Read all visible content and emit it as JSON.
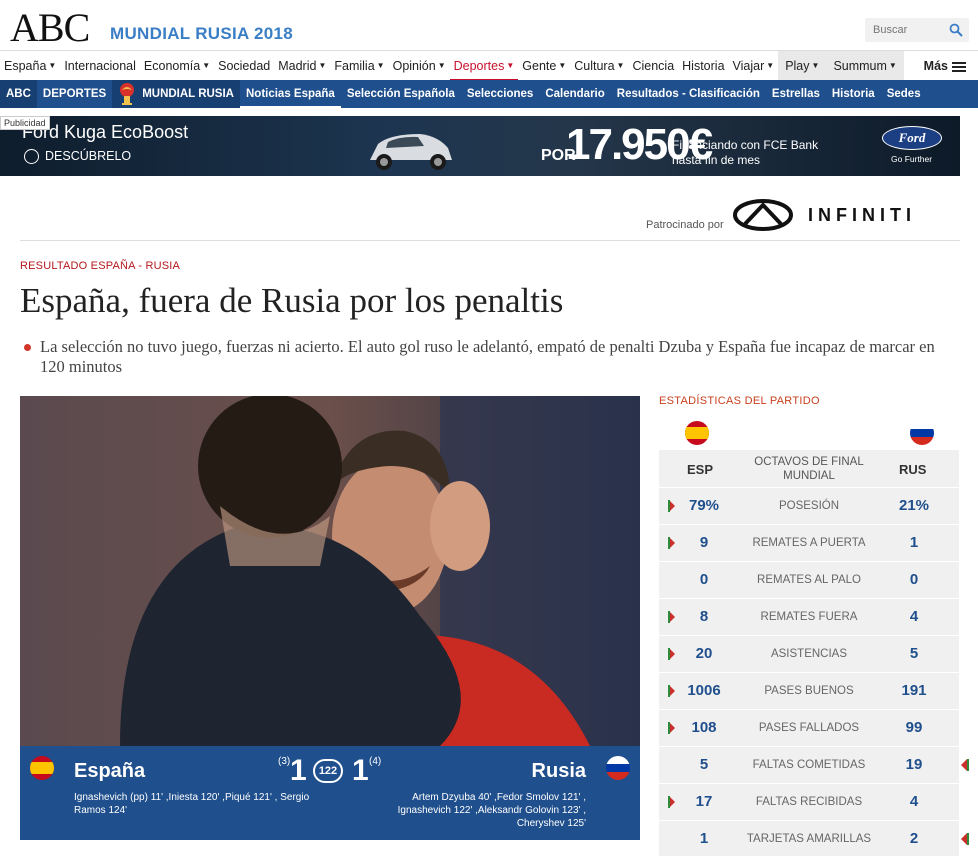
{
  "header": {
    "logo": "ABC",
    "section": "MUNDIAL RUSIA 2018",
    "search_placeholder": "Buscar"
  },
  "nav_main": [
    {
      "label": "España",
      "caret": true
    },
    {
      "label": "Internacional",
      "caret": false
    },
    {
      "label": "Economía",
      "caret": true
    },
    {
      "label": "Sociedad",
      "caret": false
    },
    {
      "label": "Madrid",
      "caret": true
    },
    {
      "label": "Familia",
      "caret": true
    },
    {
      "label": "Opinión",
      "caret": true
    },
    {
      "label": "Deportes",
      "caret": true,
      "active": true
    },
    {
      "label": "Gente",
      "caret": true
    },
    {
      "label": "Cultura",
      "caret": true
    },
    {
      "label": "Ciencia",
      "caret": false
    },
    {
      "label": "Historia",
      "caret": false
    },
    {
      "label": "Viajar",
      "caret": true
    },
    {
      "label": "Play",
      "caret": true,
      "grey": true
    },
    {
      "label": "Summum",
      "caret": true,
      "grey": true
    }
  ],
  "nav_more": "Más",
  "nav_sub": {
    "abc": "ABC",
    "deportes": "DEPORTES",
    "mundial": "MUNDIAL RUSIA",
    "items": [
      "Noticias España",
      "Selección Española",
      "Selecciones",
      "Calendario",
      "Resultados - Clasificación",
      "Estrellas",
      "Historia",
      "Sedes"
    ]
  },
  "ad": {
    "tag": "Publicidad",
    "title": "Ford Kuga EcoBoost",
    "cta": "DESCÚBRELO",
    "price_prefix": "POR",
    "price": "17.950€",
    "finance_1": "Financiando con FCE Bank",
    "finance_2": "hasta fin de mes",
    "brand": "Ford",
    "brand_sub": "Go Further"
  },
  "sponsor": {
    "label": "Patrocinado por",
    "brand": "INFINITI"
  },
  "article": {
    "kicker": "RESULTADO ESPAÑA - RUSIA",
    "headline": "España, fuera de Rusia por los penaltis",
    "summary": "La selección no tuvo juego, fuerzas ni acierto. El auto gol ruso le adelantó, empató de penalti Dzuba y España fue incapaz de marcar en 120 minutos"
  },
  "scoreboard": {
    "home": "España",
    "away": "Rusia",
    "home_goals": "1",
    "away_goals": "1",
    "home_pens": "(3)",
    "away_pens": "(4)",
    "minute": "122",
    "home_scorers": "Ignashevich (pp) 11' ,Iniesta 120' ,Piqué 121' , Sergio Ramos 124'",
    "away_scorers": "Artem Dzyuba 40' ,Fedor Smolov 121' , Ignashevich 122' ,Aleksandr Golovin 123' , Cheryshev 125'"
  },
  "stats": {
    "title": "ESTADÍSTICAS DEL PARTIDO",
    "home_abbr": "ESP",
    "away_abbr": "RUS",
    "round": "OCTAVOS DE FINAL MUNDIAL",
    "rows": [
      {
        "label": "POSESIÓN",
        "home": "79%",
        "away": "21%",
        "lead": "home"
      },
      {
        "label": "REMATES A PUERTA",
        "home": "9",
        "away": "1",
        "lead": "home"
      },
      {
        "label": "REMATES AL PALO",
        "home": "0",
        "away": "0",
        "lead": "none"
      },
      {
        "label": "REMATES FUERA",
        "home": "8",
        "away": "4",
        "lead": "home"
      },
      {
        "label": "ASISTENCIAS",
        "home": "20",
        "away": "5",
        "lead": "home"
      },
      {
        "label": "PASES BUENOS",
        "home": "1006",
        "away": "191",
        "lead": "home"
      },
      {
        "label": "PASES FALLADOS",
        "home": "108",
        "away": "99",
        "lead": "home"
      },
      {
        "label": "FALTAS COMETIDAS",
        "home": "5",
        "away": "19",
        "lead": "away"
      },
      {
        "label": "FALTAS RECIBIDAS",
        "home": "17",
        "away": "4",
        "lead": "home"
      },
      {
        "label": "TARJETAS AMARILLAS",
        "home": "1",
        "away": "2",
        "lead": "away"
      }
    ]
  },
  "colors": {
    "accent_blue": "#1f4f8c",
    "accent_red": "#c8102e",
    "section_blue": "#3a7ec6"
  }
}
